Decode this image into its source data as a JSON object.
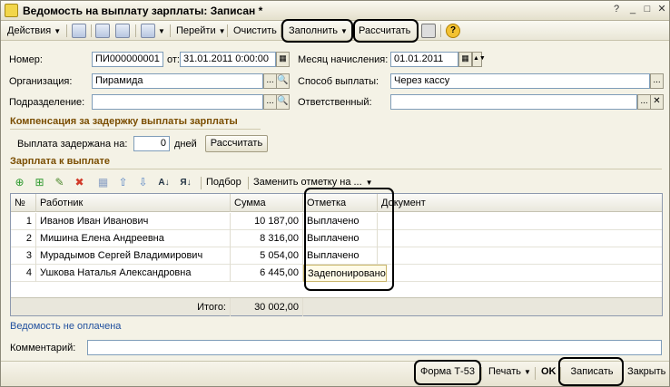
{
  "window": {
    "title": "Ведомость на выплату зарплаты: Записан *"
  },
  "toolbar": {
    "actions": "Действия",
    "goto": "Перейти",
    "clear": "Очистить",
    "fill": "Заполнить",
    "calculate": "Рассчитать"
  },
  "form": {
    "number_label": "Номер:",
    "number_value": "ПИ000000001",
    "from_label": "от:",
    "date_value": "31.01.2011  0:00:00",
    "month_label": "Месяц начисления:",
    "month_value": "01.01.2011",
    "org_label": "Организация:",
    "org_value": "Пирамида",
    "payment_label": "Способ выплаты:",
    "payment_value": "Через кассу",
    "division_label": "Подразделение:",
    "division_value": "",
    "responsible_label": "Ответственный:",
    "responsible_value": ""
  },
  "compensation": {
    "title": "Компенсация за задержку выплаты зарплаты",
    "delay_label": "Выплата задержана на:",
    "delay_value": "0",
    "days_label": "дней",
    "calc_button": "Рассчитать"
  },
  "payroll": {
    "title": "Зарплата к выплате",
    "pick_label": "Подбор",
    "replace_label": "Заменить отметку на ...",
    "columns": {
      "num": "№",
      "employee": "Работник",
      "sum": "Сумма",
      "mark": "Отметка",
      "doc": "Документ"
    },
    "rows": [
      {
        "n": "1",
        "employee": "Иванов Иван Иванович",
        "sum": "10 187,00",
        "mark": "Выплачено"
      },
      {
        "n": "2",
        "employee": "Мишина  Елена  Андреевна",
        "sum": "8 316,00",
        "mark": "Выплачено"
      },
      {
        "n": "3",
        "employee": "Мурадымов Сергей Владимирович",
        "sum": "5 054,00",
        "mark": "Выплачено"
      },
      {
        "n": "4",
        "employee": "Ушкова Наталья Александровна",
        "sum": "6 445,00",
        "mark": "Задепонировано"
      }
    ],
    "total_label": "Итого:",
    "total_value": "30 002,00"
  },
  "status_link": "Ведомость не оплачена",
  "comment": {
    "label": "Комментарий:",
    "value": ""
  },
  "bottom": {
    "form_t53": "Форма Т-53",
    "print": "Печать",
    "ok": "OK",
    "save": "Записать",
    "close": "Закрыть"
  }
}
